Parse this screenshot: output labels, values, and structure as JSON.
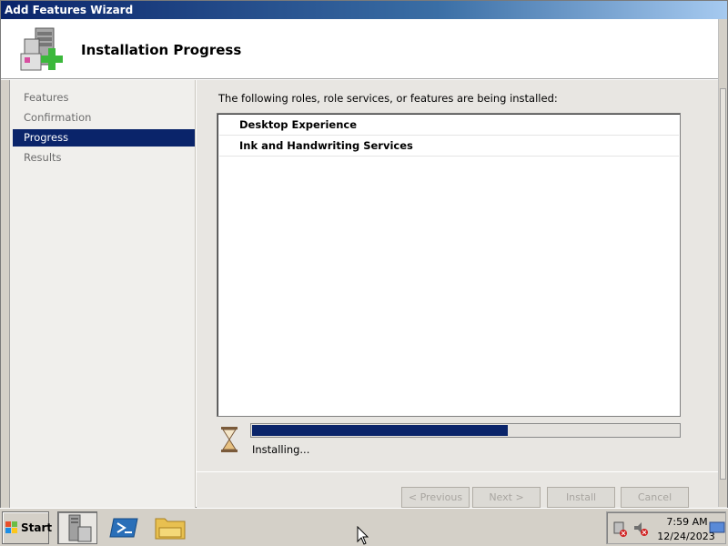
{
  "window": {
    "title": "Add Features Wizard"
  },
  "header": {
    "title": "Installation Progress",
    "icon": "server-add-icon"
  },
  "steps": [
    {
      "label": "Features",
      "active": false
    },
    {
      "label": "Confirmation",
      "active": false
    },
    {
      "label": "Progress",
      "active": true
    },
    {
      "label": "Results",
      "active": false
    }
  ],
  "main": {
    "intro": "The following roles, role services, or features are being installed:",
    "items": [
      "Desktop Experience",
      "Ink and Handwriting Services"
    ],
    "progress_fraction": 0.6,
    "status": "Installing..."
  },
  "buttons": {
    "previous": "< Previous",
    "next": "Next >",
    "install": "Install",
    "cancel": "Cancel"
  },
  "taskbar": {
    "start": "Start",
    "icons": [
      "server-manager-icon",
      "powershell-icon",
      "file-explorer-icon"
    ],
    "clock_time": "7:59 AM",
    "clock_date": "12/24/2023"
  },
  "colors": {
    "selection": "#0a246a",
    "progress": "#0a246a"
  }
}
